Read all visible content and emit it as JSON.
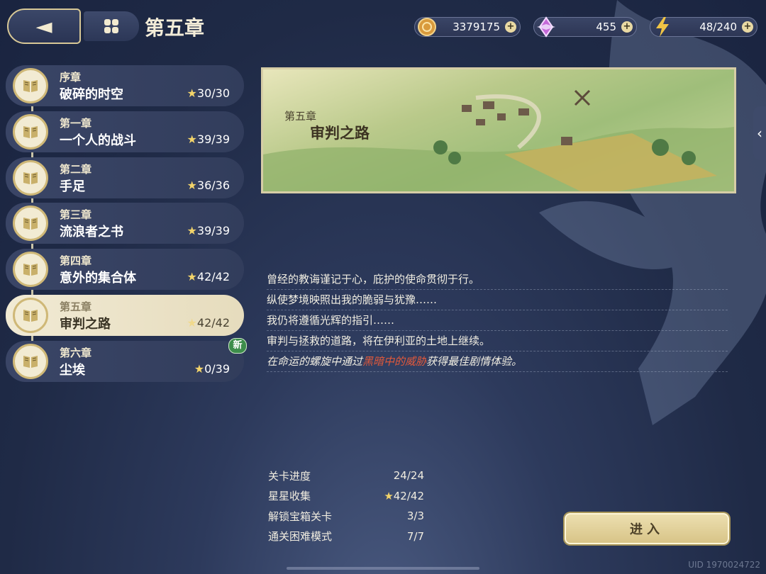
{
  "header": {
    "title": "第五章"
  },
  "resources": [
    {
      "icon": "gold-coin-icon",
      "value": "3379175"
    },
    {
      "icon": "crystal-gem-icon",
      "value": "455"
    },
    {
      "icon": "lightning-energy-icon",
      "value": "48/240"
    }
  ],
  "chapters": [
    {
      "sub": "序章",
      "name": "破碎的时空",
      "stars": "30/30"
    },
    {
      "sub": "第一章",
      "name": "一个人的战斗",
      "stars": "39/39"
    },
    {
      "sub": "第二章",
      "name": "手足",
      "stars": "36/36"
    },
    {
      "sub": "第三章",
      "name": "流浪者之书",
      "stars": "39/39"
    },
    {
      "sub": "第四章",
      "name": "意外的集合体",
      "stars": "42/42"
    },
    {
      "sub": "第五章",
      "name": "审判之路",
      "stars": "42/42",
      "active": true
    },
    {
      "sub": "第六章",
      "name": "尘埃",
      "stars": "0/39",
      "badge": "新"
    }
  ],
  "banner": {
    "sub": "第五章",
    "title": "审判之路"
  },
  "story": {
    "lines": [
      "曾经的教诲谨记于心，庇护的使命贯彻于行。",
      "纵使梦境映照出我的脆弱与犹豫……",
      "我仍将遵循光辉的指引……",
      "审判与拯救的道路，将在伊利亚的土地上继续。"
    ],
    "hint_prefix": "在命运的螺旋中通过",
    "hint_highlight": "黑暗中的威胁",
    "hint_suffix": "获得最佳剧情体验。"
  },
  "stats": [
    {
      "label": "关卡进度",
      "value": "24/24"
    },
    {
      "label": "星星收集",
      "value": "42/42",
      "star": true
    },
    {
      "label": "解锁宝箱关卡",
      "value": "3/3"
    },
    {
      "label": "通关困难模式",
      "value": "7/7"
    }
  ],
  "enter_button": "进入",
  "uid": "UID 1970024722",
  "colors": {
    "accent_gold": "#d8c896",
    "highlight_red": "#e2593b",
    "star": "#f3d46a",
    "new_badge": "#3d8d4b"
  }
}
